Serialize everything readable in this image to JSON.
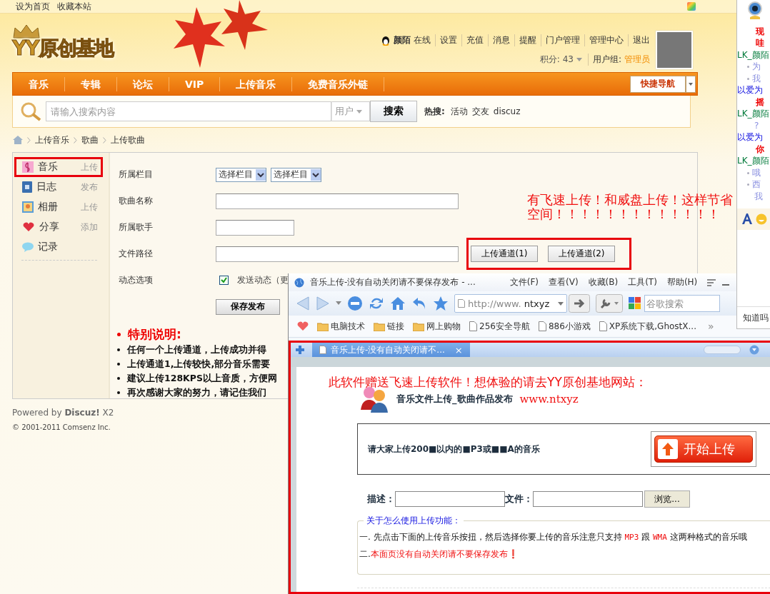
{
  "top_links": [
    "设为首页",
    "收藏本站"
  ],
  "logo": "YY原创基地",
  "user": {
    "name": "颜陌",
    "status": "在线",
    "links": [
      "设置",
      "充值",
      "消息",
      "提醒",
      "门户管理",
      "管理中心",
      "退出"
    ],
    "points": "积分: 43",
    "group_label": "用户组:",
    "group": "管理员"
  },
  "nav": {
    "items": [
      "音乐",
      "专辑",
      "论坛",
      "VIP",
      "上传音乐",
      "免费音乐外链"
    ],
    "quick_nav": "快捷导航"
  },
  "search": {
    "placeholder": "请输入搜索内容",
    "scope": "用户",
    "button": "搜索",
    "hot_label": "热搜:",
    "hot": [
      "活动",
      "交友",
      "discuz"
    ]
  },
  "breadcrumb": [
    "上传音乐",
    "歌曲",
    "上传歌曲"
  ],
  "sidebar": {
    "items": [
      {
        "label": "音乐",
        "action": "上传",
        "highlighted": true
      },
      {
        "label": "日志",
        "action": "发布",
        "highlighted": false
      },
      {
        "label": "相册",
        "action": "上传",
        "highlighted": false
      },
      {
        "label": "分享",
        "action": "添加",
        "highlighted": false
      },
      {
        "label": "记录",
        "highlighted": false
      }
    ]
  },
  "form": {
    "rows": [
      {
        "kind": "selects",
        "label": "所属栏目",
        "options": [
          "选择栏目",
          "选择栏目"
        ]
      },
      {
        "kind": "input",
        "label": "歌曲名称"
      },
      {
        "kind": "input",
        "label": "所属歌手"
      },
      {
        "kind": "file",
        "label": "文件路径",
        "buttons": [
          "上传通道(1)",
          "上传通道(2)"
        ],
        "highlighted": true
      },
      {
        "kind": "checkbox",
        "label": "动态选项",
        "checked": true,
        "text": "发送动态（更"
      }
    ],
    "submit": "保存发布"
  },
  "notice": {
    "title": "特别说明:",
    "items": [
      "任何一个上传通道，上传成功并得",
      "上传通道1,上传较快,部分音乐需要",
      "建议上传128KPS以上音质，方便网",
      "再次感谢大家的努力，请记住我们"
    ]
  },
  "annotation": {
    "lines": [
      "有飞速上传！和威盘上传！这样节省",
      "空间！！！！！！！！！！！！！"
    ]
  },
  "footer": {
    "powered": "Powered by **Discuz!** X2",
    "copyright": "© 2001-2011 Comsenz Inc."
  },
  "chat": {
    "entries": [
      {
        "kind": "title",
        "text": "现"
      },
      {
        "kind": "title",
        "text": "哇"
      },
      {
        "kind": "user",
        "text": "LK_颜陌"
      },
      {
        "kind": "msg",
        "text": "为"
      },
      {
        "kind": "msg",
        "text": "我"
      },
      {
        "kind": "friend",
        "text": "以爱为"
      },
      {
        "kind": "title",
        "text": "摇"
      },
      {
        "kind": "user",
        "text": "LK_颜陌"
      },
      {
        "kind": "note",
        "text": "?"
      },
      {
        "kind": "friend",
        "text": "以爱为"
      },
      {
        "kind": "title",
        "text": "你"
      },
      {
        "kind": "user",
        "text": "LK_颜陌"
      },
      {
        "kind": "msg",
        "text": "哦"
      },
      {
        "kind": "msg",
        "text": "西"
      },
      {
        "kind": "note",
        "text": "我"
      }
    ],
    "bottom_text": "知道吗"
  },
  "browser": {
    "title": "音乐上传-没有自动关闭请不要保存发布 - ...",
    "menu": [
      "文件(F)",
      "查看(V)",
      "收藏(B)",
      "工具(T)",
      "帮助(H)"
    ],
    "address_prefix": "http://www.",
    "address_host": "ntxyz",
    "search_placeholder": "谷歌搜索",
    "favorites": [
      {
        "kind": "folder",
        "label": "电脑技术"
      },
      {
        "kind": "folder",
        "label": "链接"
      },
      {
        "kind": "folder",
        "label": "网上购物"
      },
      {
        "kind": "page",
        "label": "256安全导航"
      },
      {
        "kind": "page",
        "label": "886小游戏"
      },
      {
        "kind": "page",
        "label": "XP系统下载,GhostX..."
      }
    ],
    "more": "»",
    "tab": {
      "title": "音乐上传-没有自动关闭请不...",
      "close": "×"
    },
    "highlighted": true,
    "page": {
      "promo": "此软件赠送飞速上传软件！想体验的请去YY原创基地网站：",
      "promo_url": "www.ntxyz",
      "heading": "音乐文件上传_歌曲作品发布",
      "notice": "请大家上传200■以内的■P3或■■A的音乐",
      "upload_button": "开始上传",
      "desc_label": "描述：",
      "file_label": "文件：",
      "browse": "浏览...",
      "help_title": "关于怎么使用上传功能：",
      "help_lines": [
        [
          {
            "kind": "plain",
            "text": "一.  先点击下面的上传音乐按扭，然后选择你要上传的音乐注意只支持 "
          },
          {
            "kind": "code",
            "text": "MP3"
          },
          {
            "kind": "plain",
            "text": " 跟 "
          },
          {
            "kind": "code",
            "text": "WMA"
          },
          {
            "kind": "plain",
            "text": " 这两种格式的音乐哦"
          }
        ],
        [
          {
            "kind": "plain",
            "text": "二."
          },
          {
            "kind": "warn",
            "text": "本面页没有自动关闭请不要保存发布❗"
          }
        ]
      ]
    }
  }
}
